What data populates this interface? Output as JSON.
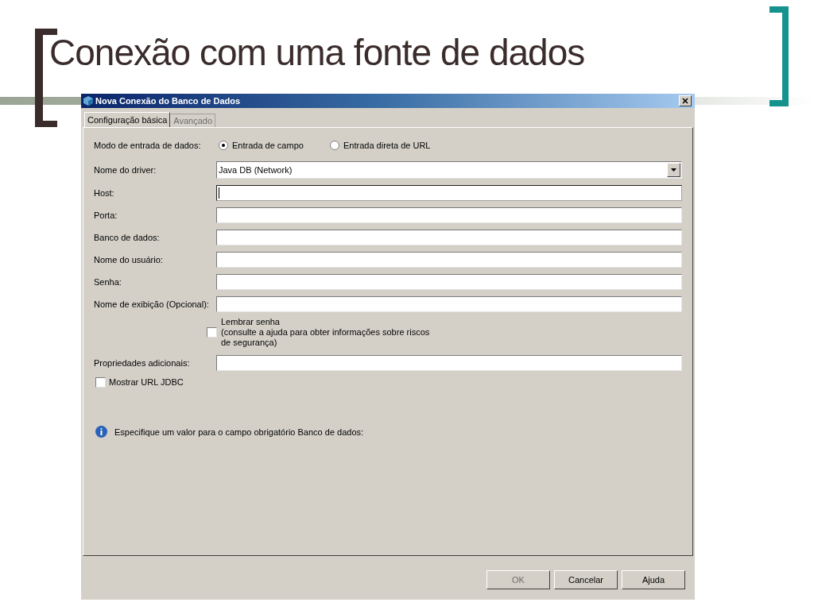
{
  "slide": {
    "title": "Conexão com uma fonte de dados"
  },
  "window": {
    "title": "Nova Conexão do Banco de Dados"
  },
  "tabs": [
    {
      "label": "Configuração básica",
      "selected": true,
      "disabled": false
    },
    {
      "label": "Avançado",
      "selected": false,
      "disabled": true
    }
  ],
  "mode": {
    "label": "Modo de entrada de dados:",
    "options": [
      {
        "label": "Entrada de campo",
        "selected": true
      },
      {
        "label": "Entrada direta de URL",
        "selected": false
      }
    ]
  },
  "driver": {
    "label": "Nome do driver:",
    "value": "Java DB (Network)"
  },
  "fields": [
    {
      "label": "Host:",
      "focused": true
    },
    {
      "label": "Porta:",
      "focused": false
    },
    {
      "label": "Banco de dados:",
      "focused": false
    },
    {
      "label": "Nome do usuário:",
      "focused": false
    },
    {
      "label": "Senha:",
      "focused": false
    },
    {
      "label": "Nome de exibição (Opcional):",
      "focused": false
    }
  ],
  "remember": {
    "label": "Lembrar senha",
    "note": "(consulte a ajuda para obter informações sobre riscos de segurança)",
    "checked": false
  },
  "extra_field": {
    "label": "Propriedades adicionais:"
  },
  "show_url": {
    "label": "Mostrar URL JDBC",
    "checked": false
  },
  "message": "Especifique um valor para o campo obrigatório Banco de dados:",
  "buttons": [
    {
      "label": "OK",
      "disabled": true
    },
    {
      "label": "Cancelar",
      "disabled": false
    },
    {
      "label": "Ajuda",
      "disabled": false
    }
  ]
}
